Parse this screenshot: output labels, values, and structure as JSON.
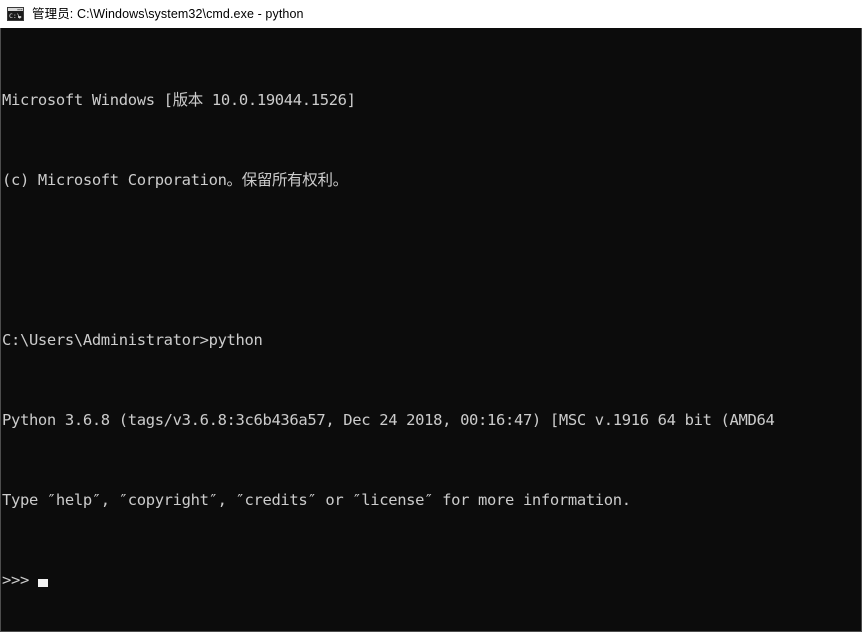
{
  "window": {
    "title": "管理员: C:\\Windows\\system32\\cmd.exe - python",
    "icon": "cmd-console-icon",
    "titlebar_bg": "#ffffff",
    "titlebar_text_color": "#000000",
    "console_bg": "#0c0c0c",
    "console_text_color": "#cccccc",
    "border_color": "#4d4d4d"
  },
  "console": {
    "lines": [
      {
        "name": "line-windows-version",
        "text": "Microsoft Windows [版本 10.0.19044.1526]"
      },
      {
        "name": "line-copyright",
        "text": "(c) Microsoft Corporation。保留所有权利。"
      },
      {
        "name": "line-blank",
        "text": ""
      },
      {
        "name": "line-command-prompt",
        "text": "C:\\Users\\Administrator>python"
      },
      {
        "name": "line-python-banner",
        "text": "Python 3.6.8 (tags/v3.6.8:3c6b436a57, Dec 24 2018, 00:16:47) [MSC v.1916 64 bit (AMD64"
      },
      {
        "name": "line-python-help-hint",
        "text": "Type ″help″, ″copyright″, ″credits″ or ″license″ for more information."
      }
    ],
    "prompt": ">>> ",
    "cursor": "block-cursor"
  }
}
